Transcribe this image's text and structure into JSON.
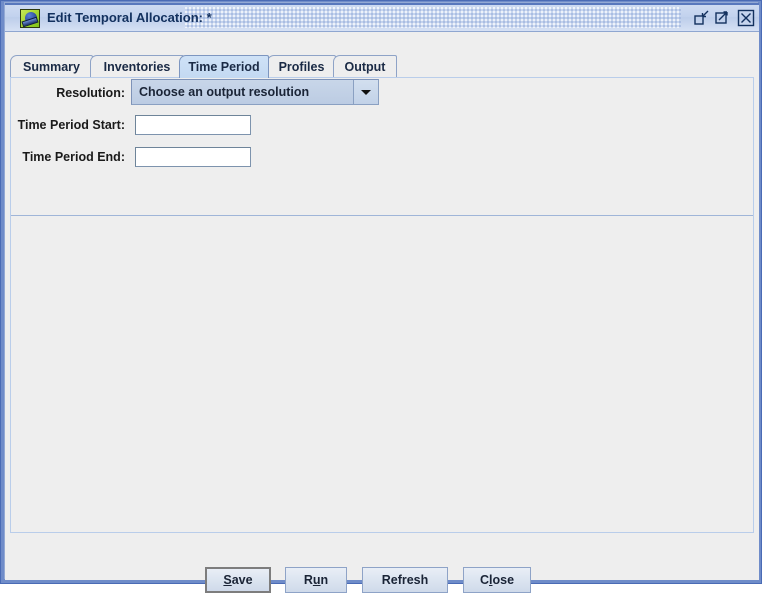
{
  "window": {
    "title": "Edit Temporal Allocation: *",
    "icon_name": "app-icon",
    "controls": {
      "restore_label": "Restore",
      "maximize_label": "Maximize",
      "close_label": "Close"
    }
  },
  "tabs": [
    {
      "id": "summary",
      "label": "Summary",
      "selected": false
    },
    {
      "id": "inventories",
      "label": "Inventories",
      "selected": false
    },
    {
      "id": "timeperiod",
      "label": "Time Period",
      "selected": true
    },
    {
      "id": "profiles",
      "label": "Profiles",
      "selected": false
    },
    {
      "id": "output",
      "label": "Output",
      "selected": false
    }
  ],
  "form": {
    "resolution": {
      "label": "Resolution:",
      "selected_option": "Choose an output resolution"
    },
    "time_period_start": {
      "label": "Time Period Start:",
      "value": "",
      "placeholder": ""
    },
    "time_period_end": {
      "label": "Time Period End:",
      "value": "",
      "placeholder": ""
    }
  },
  "buttons": {
    "save": {
      "label": "Save",
      "mnemonic": "S",
      "default": true
    },
    "run": {
      "label": "Run",
      "mnemonic": "u",
      "default": false
    },
    "refresh": {
      "label": "Refresh",
      "mnemonic": "",
      "default": false
    },
    "close": {
      "label": "Close",
      "mnemonic": "l",
      "default": false
    }
  },
  "colors": {
    "title_text": "#12305e",
    "frame": "#6f8cc9",
    "panel_bg": "#eeeeee",
    "tab_selected_bg": "#c9deF5",
    "combo_bg": "#c8d6e9",
    "field_bg": "#ffffff"
  }
}
